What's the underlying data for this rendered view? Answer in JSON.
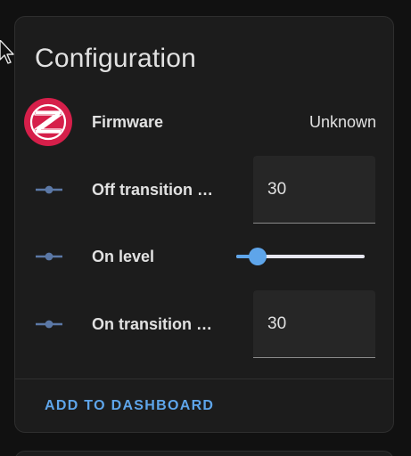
{
  "card": {
    "title": "Configuration",
    "action_label": "ADD TO DASHBOARD"
  },
  "rows": [
    {
      "icon": "firmware-logo-icon",
      "label": "Firmware",
      "value": "Unknown"
    },
    {
      "icon": "commit-icon",
      "label": "Off transition …",
      "value": "30"
    },
    {
      "icon": "commit-icon",
      "label": "On level",
      "slider_value_fraction": 0.17
    },
    {
      "icon": "commit-icon",
      "label": "On transition t…",
      "value": "30"
    }
  ],
  "colors": {
    "accent": "#5ea5ea",
    "firmware_logo": "#d61f4a",
    "icon": "#5b78a6",
    "card_background": "#1c1c1c",
    "page_background": "#111111"
  }
}
